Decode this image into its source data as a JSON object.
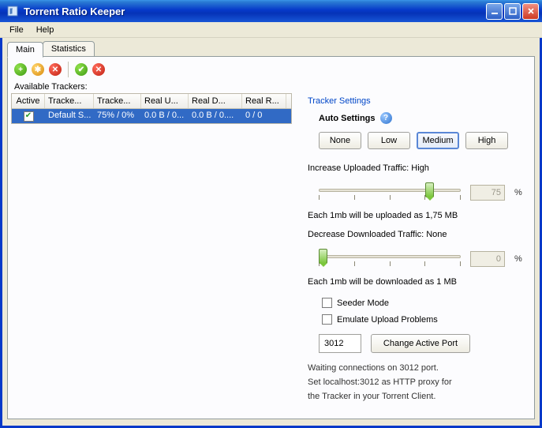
{
  "window": {
    "title": "Torrent Ratio Keeper"
  },
  "menu": {
    "file": "File",
    "help": "Help"
  },
  "tabs": {
    "main": "Main",
    "statistics": "Statistics"
  },
  "toolbar_label": "Available Trackers:",
  "table": {
    "headers": [
      "Active",
      "Tracke...",
      "Tracke...",
      "Real U...",
      "Real D...",
      "Real R..."
    ],
    "row": {
      "active": true,
      "name": "Default S...",
      "tracked": "75% / 0%",
      "real_u": "0.0 B / 0...",
      "real_d": "0.0 B / 0....",
      "real_r": "0 / 0"
    }
  },
  "settings": {
    "title": "Tracker Settings",
    "auto_label": "Auto Settings",
    "presets": {
      "none": "None",
      "low": "Low",
      "medium": "Medium",
      "high": "High",
      "selected": "Medium"
    },
    "increase_label": "Increase Uploaded Traffic: High",
    "increase_value": "75",
    "increase_pct": "%",
    "each_upload": "Each 1mb will be uploaded as 1,75 MB",
    "decrease_label": "Decrease Downloaded Traffic: None",
    "decrease_value": "0",
    "decrease_pct": "%",
    "each_download": "Each 1mb will be downloaded as 1 MB",
    "seeder_mode": "Seeder Mode",
    "emulate": "Emulate Upload Problems",
    "port_value": "3012",
    "change_port": "Change Active Port",
    "info1": "Waiting connections on 3012 port.",
    "info2": "Set localhost:3012 as HTTP proxy for",
    "info3": "the Tracker in your Torrent Client."
  }
}
